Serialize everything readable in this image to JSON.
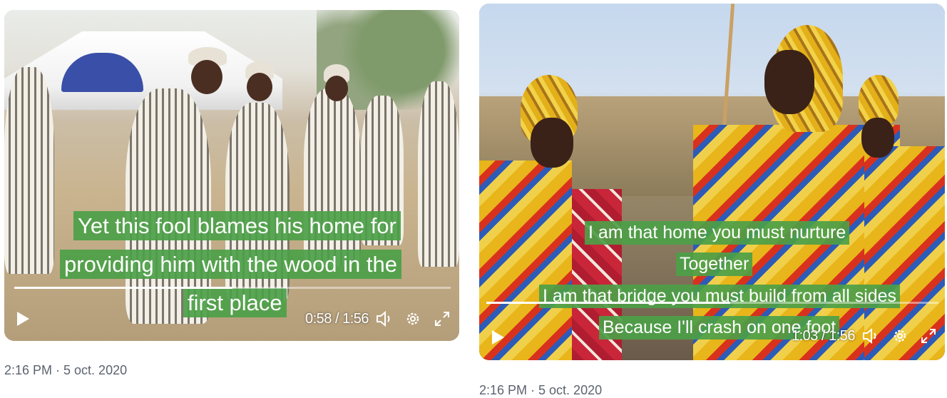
{
  "tweets": [
    {
      "video": {
        "caption_lines": [
          "Yet this fool blames his home for",
          "providing him with the wood in the",
          "first place"
        ],
        "time_current": "0:58",
        "time_separator": "/",
        "time_total": "1:56",
        "progress_fraction": 0.5
      },
      "timestamp": "2:16 PM · 5 oct. 2020"
    },
    {
      "video": {
        "caption_lines": [
          "I am that home you must nurture",
          "Together",
          "I am that bridge you must build from all sides",
          "Because I'll crash on one foot"
        ],
        "time_current": "1:03",
        "time_separator": "/",
        "time_total": "1:56",
        "progress_fraction": 0.54
      },
      "timestamp": "2:16 PM · 5 oct. 2020"
    }
  ],
  "icons": {
    "play": "play-icon",
    "volume": "volume-icon",
    "settings": "gear-icon",
    "fullscreen": "fullscreen-icon"
  },
  "colors": {
    "caption_bg": "#4ca048",
    "caption_text": "#ffffff",
    "timestamp_text": "#5b6470"
  }
}
